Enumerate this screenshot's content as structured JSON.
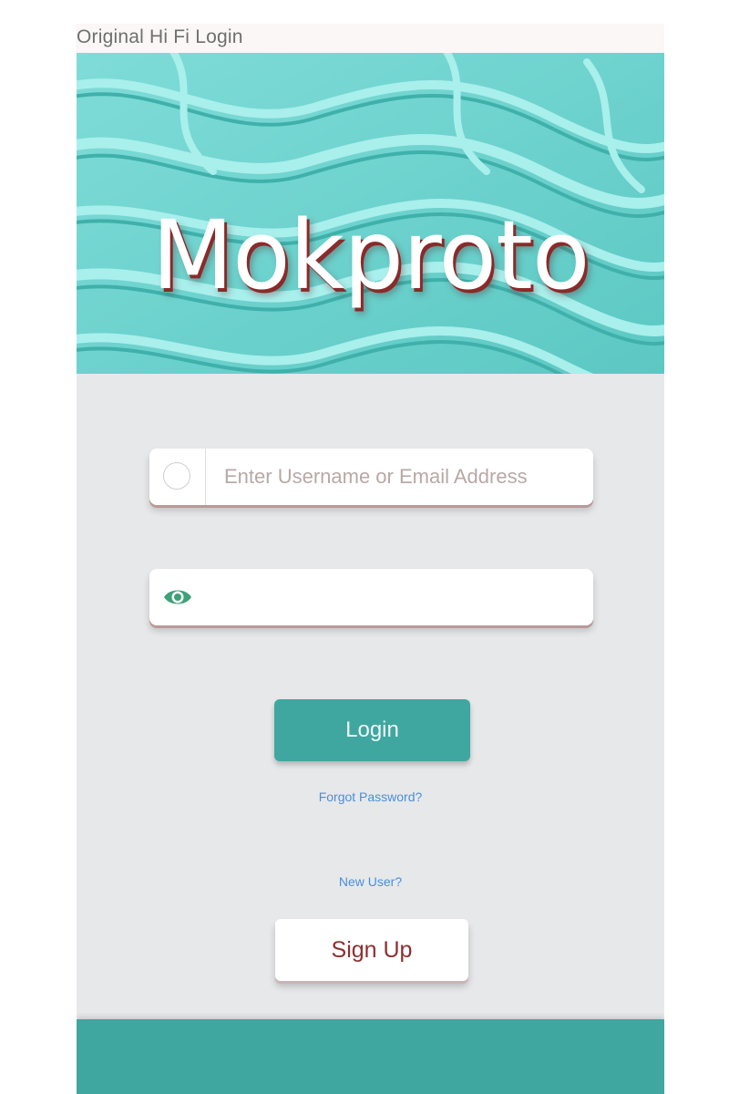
{
  "caption": "Original Hi Fi Login",
  "app": {
    "logo_text": "Mokproto"
  },
  "login_form": {
    "username_placeholder": "Enter Username or Email Address",
    "username_value": "",
    "password_value": "",
    "user_icon": "user-circle-icon",
    "password_icon": "eye-icon",
    "login_label": "Login",
    "forgot_label": "Forgot Password?",
    "new_user_label": "New User?",
    "signup_label": "Sign Up"
  },
  "colors": {
    "teal_accent": "#3fa7a0",
    "hero_teal": "#71d3cf",
    "background": "#e7e8ea",
    "link_blue": "#4a8fd6",
    "brand_maroon": "#8e2f2f"
  }
}
